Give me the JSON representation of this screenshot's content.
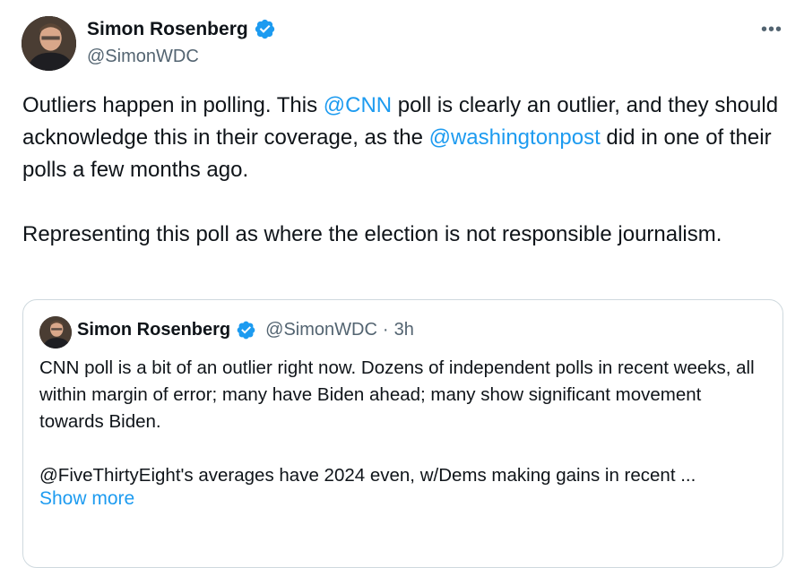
{
  "tweet": {
    "author_name": "Simon Rosenberg",
    "author_handle": "@SimonWDC",
    "more_label": "•••",
    "text": {
      "p1_a": "Outliers happen in polling.  This ",
      "p1_mention1": "@CNN",
      "p1_b": " poll is clearly an outlier, and they should acknowledge this in their coverage, as the ",
      "p1_mention2": "@washingtonpost",
      "p1_c": " did in one of their polls a few months ago.",
      "p2": "Representing this poll as where the election is not responsible journalism."
    }
  },
  "quoted_tweet": {
    "author_name": "Simon Rosenberg",
    "author_handle": "@SimonWDC",
    "separator": "·",
    "time": "3h",
    "p1": "CNN poll is a bit of an outlier right now.  Dozens of independent polls in recent weeks, all within margin of error; many have Biden ahead; many show significant movement towards Biden.",
    "p2": "@FiveThirtyEight's averages have 2024 even, w/Dems making gains in recent ...",
    "show_more": "Show more"
  },
  "colors": {
    "link": "#1d9bf0",
    "verified": "#1d9bf0",
    "secondary_text": "#536471",
    "border": "#cfd9de"
  },
  "icons": {
    "verified": "verified-badge-icon",
    "more": "more-dots-icon"
  }
}
